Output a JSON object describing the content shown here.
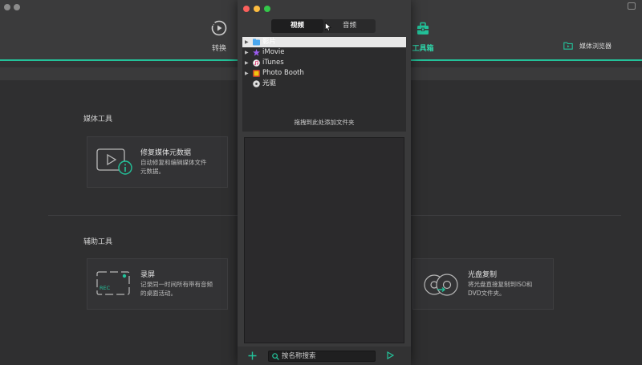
{
  "toolbar": {
    "convert_label": "转换",
    "toolbox_label": "工具箱",
    "media_browser_label": "媒体浏览器"
  },
  "sections": {
    "media_tools_title": "媒体工具",
    "helper_tools_title": "辅助工具"
  },
  "cards": {
    "fix_metadata": {
      "title": "修复媒体元数据",
      "desc_line1": "自动修复和编辑媒体文件",
      "desc_line2": "元数据。"
    },
    "screen_record": {
      "title": "录屏",
      "desc_line1": "记录同一时间所有带有音频",
      "desc_line2": "的桌面活动。",
      "badge": "REC"
    },
    "disc_copy": {
      "title": "光盘复制",
      "desc_line1": "将光盘直接复制到ISO和",
      "desc_line2": "DVD文件夹。"
    }
  },
  "media_panel": {
    "tabs": [
      "视频",
      "音频"
    ],
    "selected_tab": "视频",
    "tree_items": [
      {
        "label": "影片",
        "icon": "movies-folder-icon",
        "expandable": true,
        "selected": true
      },
      {
        "label": "iMovie",
        "icon": "imovie-icon",
        "expandable": true,
        "selected": false
      },
      {
        "label": "iTunes",
        "icon": "itunes-icon",
        "expandable": true,
        "selected": false
      },
      {
        "label": "Photo Booth",
        "icon": "photo-booth-icon",
        "expandable": true,
        "selected": false
      },
      {
        "label": "光驱",
        "icon": "disc-drive-icon",
        "expandable": false,
        "selected": false
      }
    ],
    "drop_hint": "拖拽到此处添加文件夹",
    "search_placeholder": "按名称搜索"
  },
  "colors": {
    "accent": "#23c29a",
    "background": "#2f2f30",
    "panel": "#3a3a3b",
    "close": "#fc605c",
    "minimize": "#fdbc40",
    "zoom": "#34c84a"
  }
}
